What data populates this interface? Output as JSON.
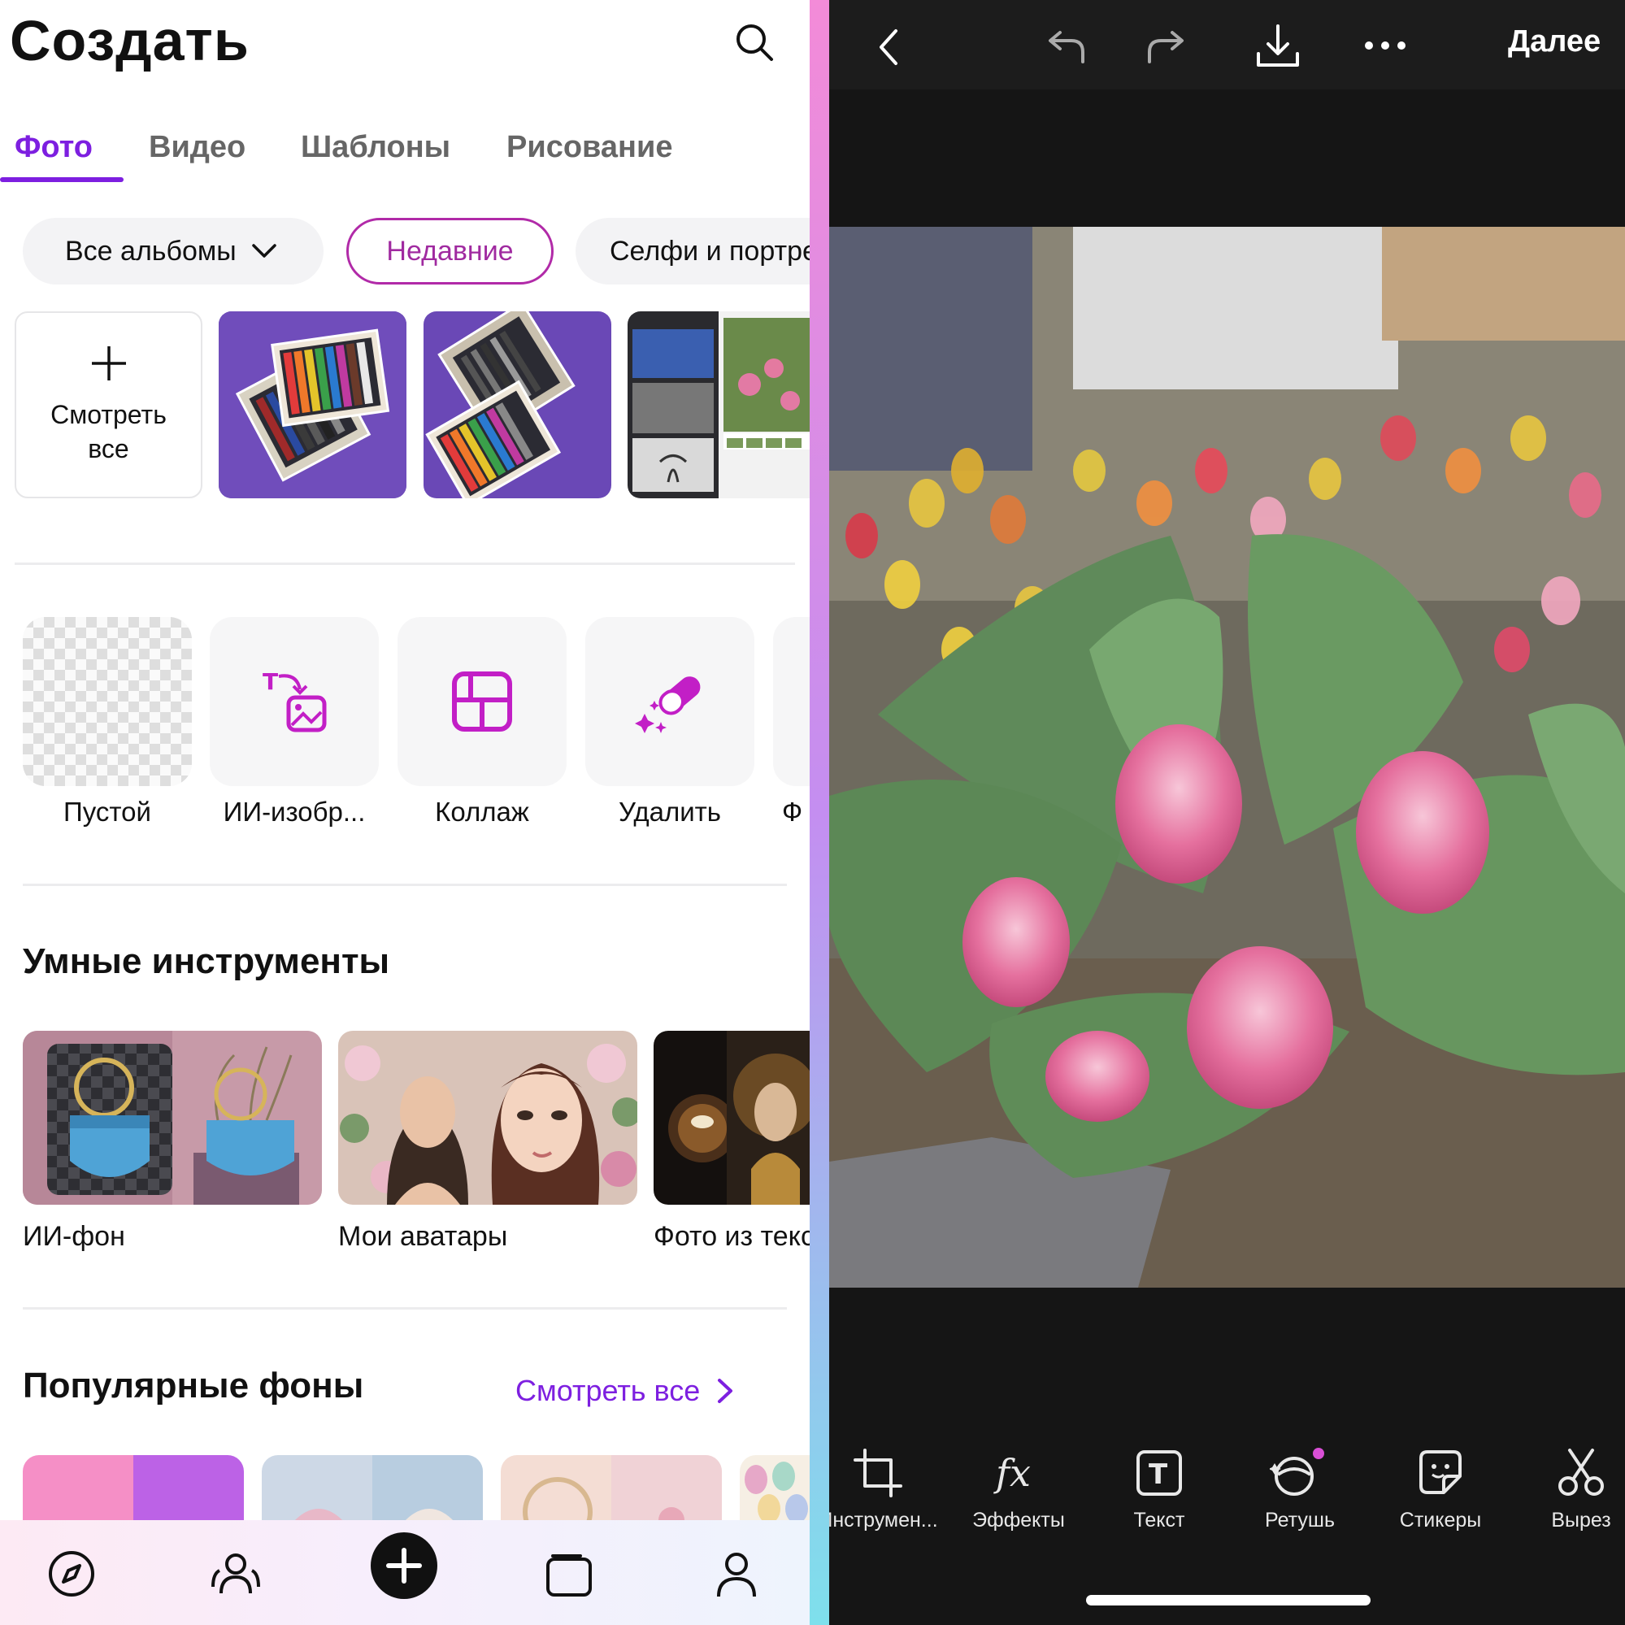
{
  "header": {
    "title": "Создать"
  },
  "tabs": [
    {
      "label": "Фото",
      "active": true
    },
    {
      "label": "Видео"
    },
    {
      "label": "Шаблоны"
    },
    {
      "label": "Рисование"
    }
  ],
  "albums": {
    "all": "Все альбомы",
    "recent": "Недавние",
    "selfie": "Селфи и портреты"
  },
  "gallery": {
    "see_all": "Смотреть все"
  },
  "tools": [
    {
      "label": "Пустой"
    },
    {
      "label": "ИИ-изобр..."
    },
    {
      "label": "Коллаж"
    },
    {
      "label": "Удалить"
    },
    {
      "label": "Ф"
    }
  ],
  "smart": {
    "title": "Умные инструменты",
    "items": [
      {
        "label": "ИИ-фон"
      },
      {
        "label": "Мои аватары"
      },
      {
        "label": "Фото из текста"
      }
    ]
  },
  "popular": {
    "title": "Популярные фоны",
    "see_all": "Смотреть все"
  },
  "editor": {
    "next": "Далее",
    "tools": [
      {
        "label": "Инструмен...",
        "icon": "crop-icon"
      },
      {
        "label": "Эффекты",
        "icon": "fx-icon"
      },
      {
        "label": "Текст",
        "icon": "text-icon"
      },
      {
        "label": "Ретушь",
        "icon": "retouch-icon"
      },
      {
        "label": "Стикеры",
        "icon": "sticker-icon"
      },
      {
        "label": "Вырез",
        "icon": "scissors-icon"
      }
    ]
  },
  "colors": {
    "accent": "#7d1fe0",
    "chip_border": "#b12aa8",
    "magenta_icon": "#c21fc6"
  }
}
